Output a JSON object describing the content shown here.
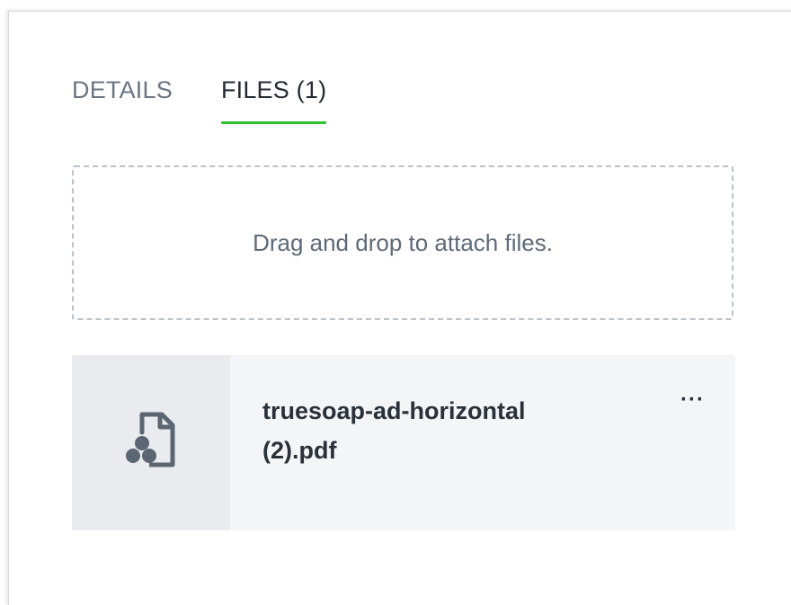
{
  "tabs": [
    {
      "label": "DETAILS",
      "active": false
    },
    {
      "label": "FILES (1)",
      "active": true
    }
  ],
  "dropzone": {
    "text": "Drag and drop to attach files."
  },
  "files": [
    {
      "name": "truesoap-ad-horizontal (2).pdf",
      "icon": "pdf-file-icon",
      "menu_label": "···"
    }
  ],
  "colors": {
    "accent": "#2fbf2f",
    "text_primary": "#222a33",
    "text_muted": "#6b7683",
    "card_bg": "#f4f5f7",
    "thumb_bg": "#e9ebee",
    "dash": "#b9c2cc"
  }
}
